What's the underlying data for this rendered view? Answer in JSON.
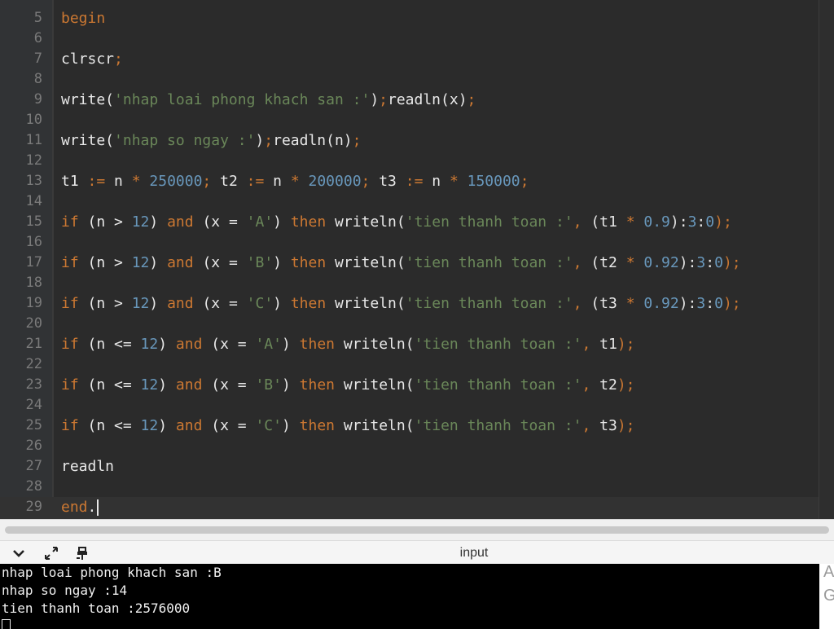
{
  "editor": {
    "line_numbers": [
      "5",
      "6",
      "7",
      "8",
      "9",
      "10",
      "11",
      "12",
      "13",
      "14",
      "15",
      "16",
      "17",
      "18",
      "19",
      "20",
      "21",
      "22",
      "23",
      "24",
      "25",
      "26",
      "27",
      "28",
      "29"
    ],
    "code": {
      "l5": {
        "kw": "begin"
      },
      "l7": {
        "id": "clrscr",
        "p": ";"
      },
      "l9": {
        "a": "write(",
        "s": "'nhap loai phong khach san :'",
        "b": ")",
        "p1": ";",
        "c": "readln(x)",
        "p2": ";"
      },
      "l11": {
        "a": "write(",
        "s": "'nhap so ngay :'",
        "b": ")",
        "p1": ";",
        "c": "readln(n)",
        "p2": ";"
      },
      "l13": {
        "v1": "t1 ",
        "as1": ":=",
        "n1": " n ",
        "m1": "*",
        "c1": " 250000",
        "p1": ";",
        "v2": " t2 ",
        "as2": ":=",
        "n2": " n ",
        "m2": "*",
        "c2": " 200000",
        "p2": ";",
        "v3": " t3 ",
        "as3": ":=",
        "n3": " n ",
        "m3": "*",
        "c3": " 150000",
        "p3": ";"
      },
      "l15": {
        "if": "if",
        "o1": " (n > ",
        "c12": "12",
        "o2": ") ",
        "and": "and",
        "o3": " (x = ",
        "s": "'A'",
        "o4": ") ",
        "then": "then",
        "w": " writeln(",
        "msg": "'tien thanh toan :'",
        "cm": ",",
        "o5": " (t1 ",
        "mul": "*",
        "fac": " 0.9",
        "o6": "):",
        "d1": "3",
        "col": ":",
        "d2": "0",
        "end": ");"
      },
      "l17": {
        "if": "if",
        "o1": " (n > ",
        "c12": "12",
        "o2": ") ",
        "and": "and",
        "o3": " (x = ",
        "s": "'B'",
        "o4": ") ",
        "then": "then",
        "w": " writeln(",
        "msg": "'tien thanh toan :'",
        "cm": ",",
        "o5": " (t2 ",
        "mul": "*",
        "fac": " 0.92",
        "o6": "):",
        "d1": "3",
        "col": ":",
        "d2": "0",
        "end": ");"
      },
      "l19": {
        "if": "if",
        "o1": " (n > ",
        "c12": "12",
        "o2": ") ",
        "and": "and",
        "o3": " (x = ",
        "s": "'C'",
        "o4": ") ",
        "then": "then",
        "w": " writeln(",
        "msg": "'tien thanh toan :'",
        "cm": ",",
        "o5": " (t3 ",
        "mul": "*",
        "fac": " 0.92",
        "o6": "):",
        "d1": "3",
        "col": ":",
        "d2": "0",
        "end": ");"
      },
      "l21": {
        "if": "if",
        "o1": " (n <= ",
        "c12": "12",
        "o2": ") ",
        "and": "and",
        "o3": " (x = ",
        "s": "'A'",
        "o4": ") ",
        "then": "then",
        "w": " writeln(",
        "msg": "'tien thanh toan :'",
        "cm": ",",
        "t": " t1",
        "end": ");"
      },
      "l23": {
        "if": "if",
        "o1": " (n <= ",
        "c12": "12",
        "o2": ") ",
        "and": "and",
        "o3": " (x = ",
        "s": "'B'",
        "o4": ") ",
        "then": "then",
        "w": " writeln(",
        "msg": "'tien thanh toan :'",
        "cm": ",",
        "t": " t2",
        "end": ");"
      },
      "l25": {
        "if": "if",
        "o1": " (n <= ",
        "c12": "12",
        "o2": ") ",
        "and": "and",
        "o3": " (x = ",
        "s": "'C'",
        "o4": ") ",
        "then": "then",
        "w": " writeln(",
        "msg": "'tien thanh toan :'",
        "cm": ",",
        "t": " t3",
        "end": ");"
      },
      "l27": {
        "id": "readln"
      },
      "l29": {
        "kw": "end",
        "dot": "."
      }
    }
  },
  "panel": {
    "title": "input"
  },
  "console": {
    "lines": [
      "nhap loai phong khach san :B",
      "nhap so ngay :14",
      "tien thanh toan :2576000"
    ]
  },
  "side": {
    "letters": [
      "A",
      "G"
    ]
  },
  "colors": {
    "keyword": "#cc7832",
    "number": "#6897bb",
    "string": "#6a8759",
    "identifier": "#e8e8e8",
    "background": "#2b2b2b"
  }
}
